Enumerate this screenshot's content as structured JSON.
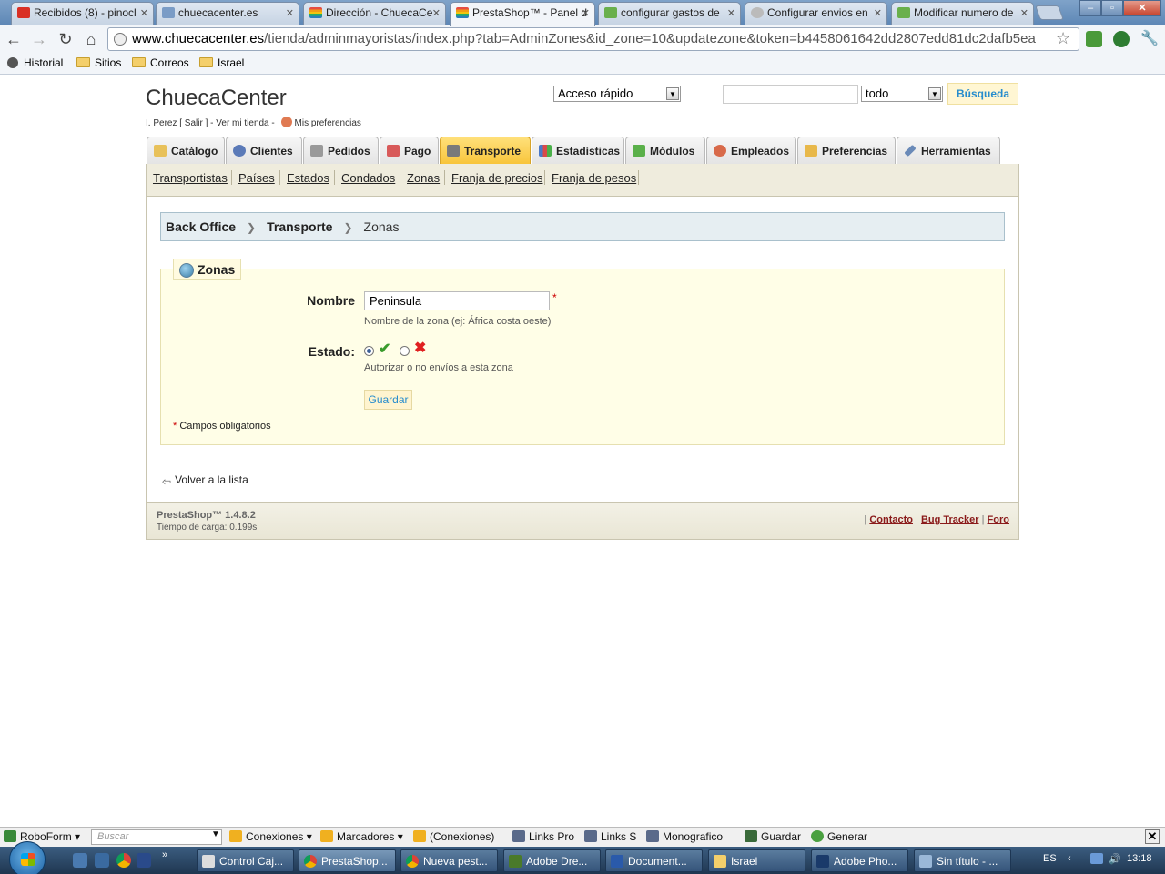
{
  "browser": {
    "tabs": [
      {
        "title": "Recibidos (8) - pinocl",
        "icon": "gmail-icon",
        "color": "#d93025"
      },
      {
        "title": "chuecacenter.es",
        "icon": "site-icon",
        "color": "#7a9cc6"
      },
      {
        "title": "Dirección - ChuecaCe",
        "icon": "rainbow-flag-icon",
        "color": "#e54d42"
      },
      {
        "title": "PrestaShop™ - Panel d",
        "icon": "rainbow-flag-icon",
        "color": "#e54d42"
      },
      {
        "title": "configurar gastos de",
        "icon": "prestashop-icon",
        "color": "#6ab04c"
      },
      {
        "title": "Configurar envios en",
        "icon": "globe-icon",
        "color": "#999999"
      },
      {
        "title": "Modificar numero de",
        "icon": "prestashop-icon",
        "color": "#6ab04c"
      }
    ],
    "url_domain": "www.chuecacenter.es",
    "url_path": "/tienda/adminmayoristas/index.php?tab=AdminZones&id_zone=10&updatezone&token=b4458061642dd2807edd81dc2dafb5ea",
    "bookmarks": {
      "history": "Historial",
      "sitios": "Sitios",
      "correos": "Correos",
      "israel": "Israel"
    }
  },
  "header": {
    "shop_name": "ChuecaCenter",
    "user": "I. Perez [",
    "logout": "Salir",
    "user_mid": "] - Ver mi tienda -",
    "preferences": "Mis preferencias",
    "quick_access": "Acceso rápido",
    "search_value": "",
    "search_scope": "todo",
    "search_button": "Búsqueda"
  },
  "tabs": [
    {
      "label": "Catálogo",
      "icon": "folder-icon",
      "color": "#e8c15a"
    },
    {
      "label": "Clientes",
      "icon": "customer-icon",
      "color": "#5b7ab8"
    },
    {
      "label": "Pedidos",
      "icon": "cart-icon",
      "color": "#9a9a9a"
    },
    {
      "label": "Pago",
      "icon": "payment-icon",
      "color": "#d85a5a"
    },
    {
      "label": "Transporte",
      "icon": "truck-icon",
      "color": "#7a7a7a"
    },
    {
      "label": "Estadísticas",
      "icon": "stats-icon",
      "color": "#4a78c8"
    },
    {
      "label": "Módulos",
      "icon": "puzzle-icon",
      "color": "#5ab04a"
    },
    {
      "label": "Empleados",
      "icon": "employee-icon",
      "color": "#d86a4a"
    },
    {
      "label": "Preferencias",
      "icon": "preferences-icon",
      "color": "#e8b84a"
    },
    {
      "label": "Herramientas",
      "icon": "wrench-icon",
      "color": "#6a8ab8"
    }
  ],
  "active_tab": "Transporte",
  "subnav": [
    "Transportistas",
    "Países",
    "Estados",
    "Condados",
    "Zonas",
    "Franja de precios",
    "Franja de pesos"
  ],
  "breadcrumb": {
    "root": "Back Office",
    "section": "Transporte",
    "current": "Zonas"
  },
  "form": {
    "legend": "Zonas",
    "name_label": "Nombre",
    "name_value": "Peninsula",
    "required_mark": "*",
    "name_hint": "Nombre de la zona (ej: África costa oeste)",
    "status_label": "Estado:",
    "status_enabled": true,
    "status_hint": "Autorizar o no envíos a esta zona",
    "save_label": "Guardar",
    "required_note": "Campos obligatorios"
  },
  "back_link": "Volver a la lista",
  "footer": {
    "version": "PrestaShop™ 1.4.8.2",
    "load_time": "Tiempo de carga: 0.199s",
    "links": [
      "Contacto",
      "Bug Tracker",
      "Foro"
    ]
  },
  "roboform": {
    "brand": "RoboForm",
    "search_placeholder": "Buscar",
    "items": [
      "Conexiones",
      "Marcadores",
      "(Conexiones)",
      "Links Pro",
      "Links S",
      "Monografico",
      "Guardar",
      "Generar"
    ]
  },
  "taskbar": {
    "buttons": [
      "Control Caj...",
      "PrestaShop...",
      "Nueva pest...",
      "Adobe Dre...",
      "Document...",
      "Israel",
      "Adobe Pho...",
      "Sin título - ..."
    ],
    "language": "ES",
    "time": "13:18"
  }
}
